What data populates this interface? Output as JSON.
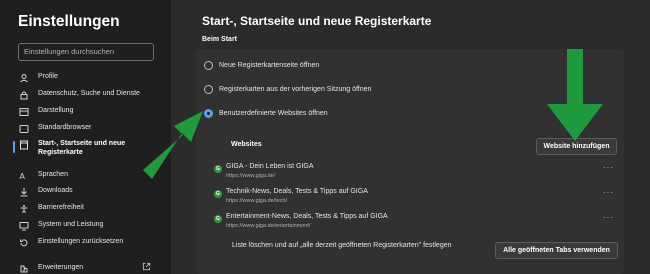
{
  "sidebar": {
    "title": "Einstellungen",
    "search_placeholder": "Einstellungen durchsuchen",
    "items": [
      {
        "label": "Profile",
        "icon": "profile-icon"
      },
      {
        "label": "Datenschutz, Suche und Dienste",
        "icon": "lock-icon"
      },
      {
        "label": "Darstellung",
        "icon": "appearance-icon"
      },
      {
        "label": "Standardbrowser",
        "icon": "browser-icon"
      },
      {
        "label_line1": "Start-, Startseite und neue",
        "label_line2": "Registerkarte",
        "icon": "start-page-icon",
        "active": true
      },
      {
        "label": "Sprachen",
        "icon": "language-icon"
      },
      {
        "label": "Downloads",
        "icon": "download-icon"
      },
      {
        "label": "Barrierefreiheit",
        "icon": "accessibility-icon"
      },
      {
        "label": "System und Leistung",
        "icon": "system-icon"
      },
      {
        "label": "Einstellungen zurücksetzen",
        "icon": "reset-icon"
      },
      {
        "label": "Erweiterungen",
        "icon": "extensions-icon"
      }
    ]
  },
  "main": {
    "title": "Start-, Startseite und neue Registerkarte",
    "section": "Beim Start",
    "options": [
      {
        "label": "Neue Registerkartenseite öffnen",
        "checked": false
      },
      {
        "label": "Registerkarten aus der vorherigen Sitzung öffnen",
        "checked": false
      },
      {
        "label": "Benutzerdefinierte Websites öffnen",
        "checked": true
      }
    ],
    "websites_label": "Websites",
    "add_button": "Website hinzufügen",
    "sites": [
      {
        "title": "GIGA - Dein Leben ist GIGA",
        "url": "https://www.giga.de/"
      },
      {
        "title": "Technik-News, Deals, Tests & Tipps auf GIGA",
        "url": "https://www.giga.de/tech/"
      },
      {
        "title": "Entertainment-News, Deals, Tests & Tipps auf GIGA",
        "url": "https://www.giga.de/entertainment/"
      }
    ],
    "more_glyph": "···",
    "bottom_text": "Liste löschen und auf „alle derzeit geöffneten Registerkarten\" festlegen",
    "use_all_tabs_button": "Alle geöffneten Tabs verwenden",
    "favicon_letter": "G"
  },
  "colors": {
    "accent": "#5aa0f0",
    "arrow": "#1f9a3e",
    "favicon": "#2f9a3c"
  }
}
